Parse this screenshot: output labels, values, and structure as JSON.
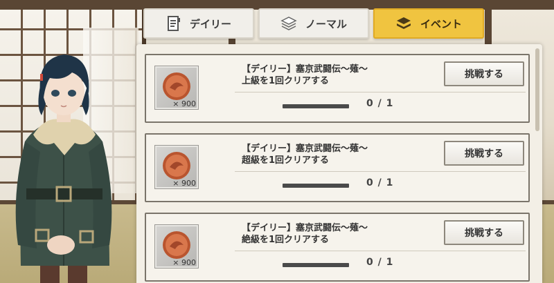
{
  "tabs": [
    {
      "label": "デイリー",
      "icon": "daily-clipboard-icon",
      "active": false
    },
    {
      "label": "ノーマル",
      "icon": "normal-stack-icon",
      "active": false
    },
    {
      "label": "イベント",
      "icon": "event-books-icon",
      "active": true
    }
  ],
  "missions": [
    {
      "title_line1": "【デイリー】塞京武闘伝～薙～",
      "title_line2": "上級を1回クリアする",
      "reward_qty": "× 900",
      "reward_icon": "bronze-medal-icon",
      "progress_text": "0 / 1",
      "progress_value": 0,
      "progress_max": 1,
      "button_label": "挑戦する"
    },
    {
      "title_line1": "【デイリー】塞京武闘伝～薙～",
      "title_line2": "超級を1回クリアする",
      "reward_qty": "× 900",
      "reward_icon": "bronze-medal-icon",
      "progress_text": "0 / 1",
      "progress_value": 0,
      "progress_max": 1,
      "button_label": "挑戦する"
    },
    {
      "title_line1": "【デイリー】塞京武闘伝～薙～",
      "title_line2": "絶級を1回クリアする",
      "reward_qty": "× 900",
      "reward_icon": "bronze-medal-icon",
      "progress_text": "0 / 1",
      "progress_value": 0,
      "progress_max": 1,
      "button_label": "挑戦する"
    }
  ],
  "colors": {
    "active_tab": "#f0c440",
    "medal": "#c8643c",
    "progress_track": "#4a4a4a"
  }
}
